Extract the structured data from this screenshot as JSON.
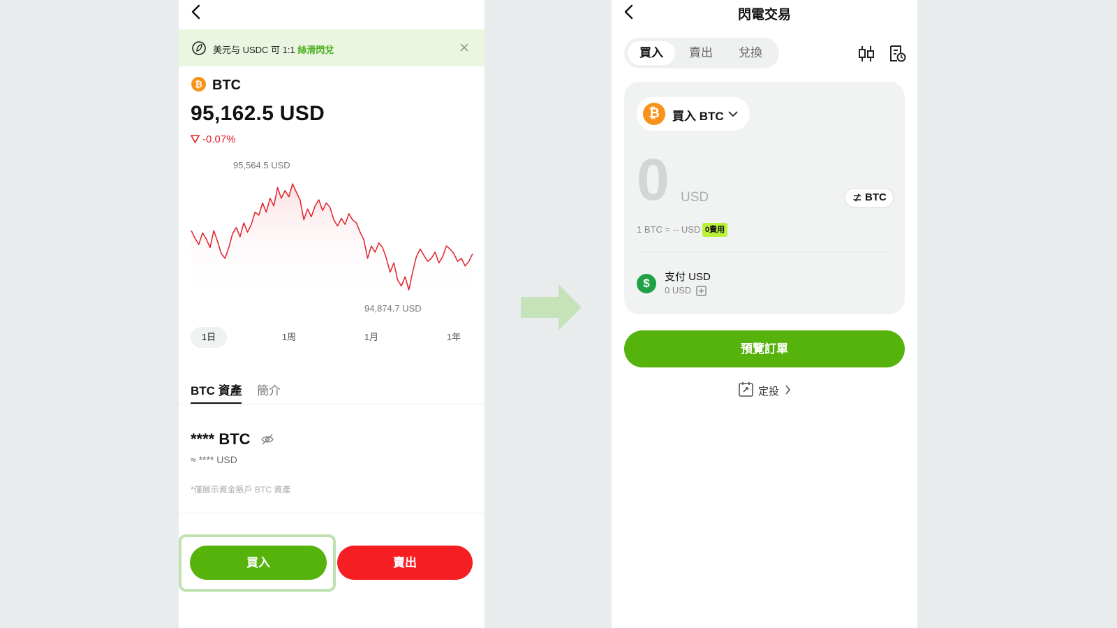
{
  "left": {
    "banner": {
      "text": "美元与 USDC 可 1:1 ",
      "highlight": "絲滑閃兌"
    },
    "coin": {
      "symbol_glyph": "₿",
      "name": "BTC"
    },
    "price": "95,162.5 USD",
    "change": "-0.07%",
    "chart_data": {
      "type": "line",
      "high_label": "95,564.5 USD",
      "low_label": "94,874.7 USD",
      "ylim": [
        94874.7,
        95564.5
      ],
      "line_color": "#e0202b",
      "values": [
        95260,
        95210,
        95170,
        95245,
        95205,
        95150,
        95260,
        95190,
        95110,
        95080,
        95150,
        95240,
        95280,
        95220,
        95310,
        95250,
        95300,
        95380,
        95360,
        95440,
        95380,
        95470,
        95420,
        95540,
        95470,
        95520,
        95480,
        95564,
        95510,
        95460,
        95330,
        95400,
        95350,
        95420,
        95460,
        95390,
        95440,
        95410,
        95330,
        95290,
        95340,
        95300,
        95370,
        95330,
        95310,
        95250,
        95200,
        95080,
        95160,
        95120,
        95180,
        95150,
        95080,
        94990,
        95050,
        94940,
        94900,
        94960,
        94875,
        94990,
        95090,
        95140,
        95100,
        95060,
        95080,
        95120,
        95050,
        95090,
        95160,
        95140,
        95110,
        95060,
        95080,
        95030,
        95060,
        95110
      ]
    },
    "ranges": [
      "1日",
      "1周",
      "1月",
      "1年"
    ],
    "tabs": [
      "BTC 資產",
      "簡介"
    ],
    "holdings": {
      "amount": "**** BTC",
      "usd": "≈ **** USD",
      "note": "*僅展示資金賬戶 BTC 資產"
    },
    "buttons": {
      "buy": "買入",
      "sell": "賣出"
    },
    "colors": {
      "buy": "#55b30c",
      "sell": "#f51e23",
      "highlight": "#bfe0b0"
    }
  },
  "right": {
    "title": "閃電交易",
    "segments": [
      "買入",
      "賣出",
      "兌換"
    ],
    "asset_selector": "買入 BTC",
    "amount": "0",
    "amount_unit": "USD",
    "switch_unit": "BTC",
    "rate": "1 BTC = -- USD",
    "fee_badge": "0費用",
    "pay": {
      "label": "支付 USD",
      "balance": "0 USD"
    },
    "preview_button": "預覽訂單",
    "recurring": "定投"
  }
}
